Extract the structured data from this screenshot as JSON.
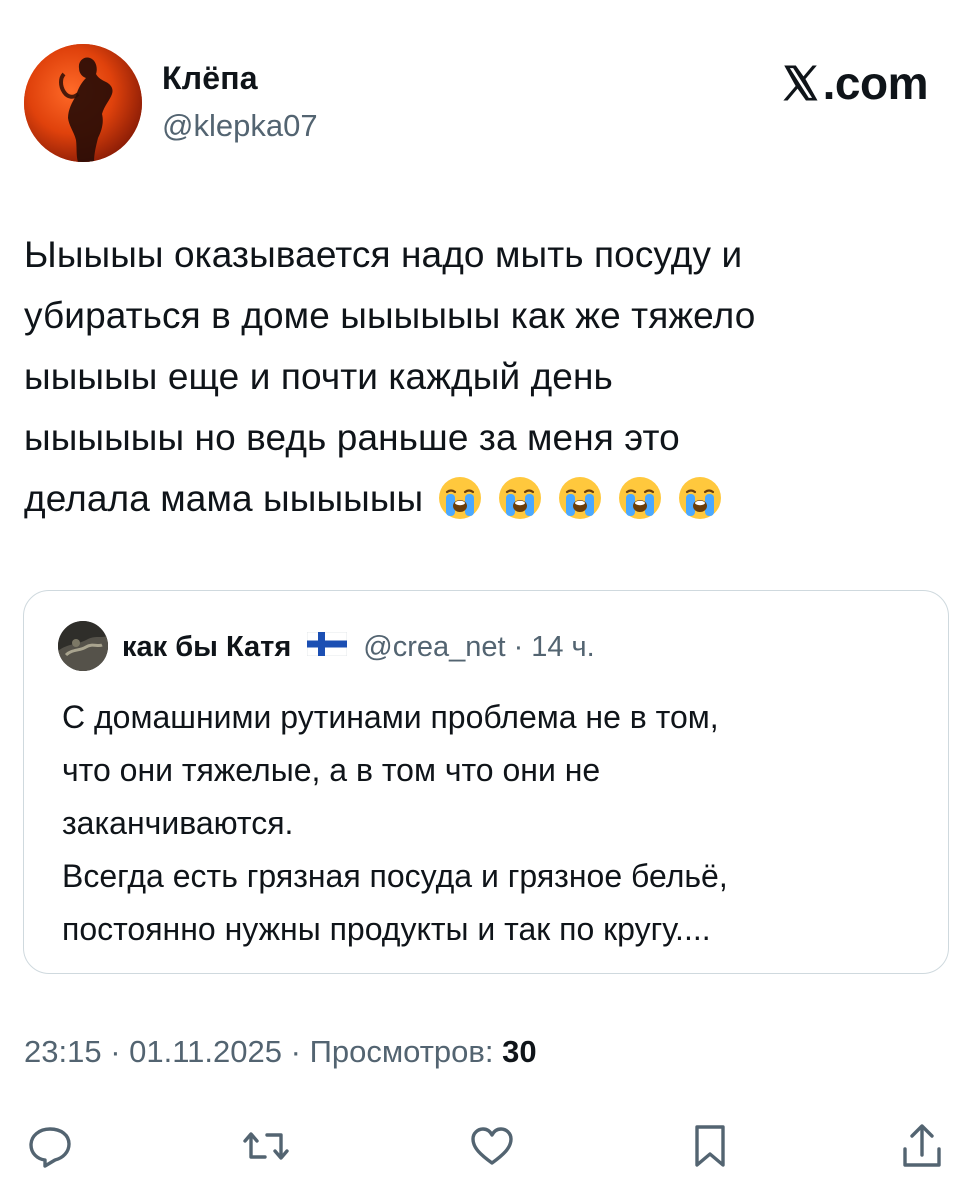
{
  "author": {
    "name": "Клёпа",
    "handle": "@klepka07"
  },
  "brand": {
    "label": ".com"
  },
  "tweet": {
    "text_lines": [
      "Ыыыыы оказывается надо мыть посуду и",
      "убираться в доме ыыыыыы как же тяжело",
      "ыыыыы еще и почти каждый день",
      "ыыыыыы но ведь раньше за меня это",
      "делала мама ыыыыыы"
    ],
    "emojis": [
      "loudly-crying-face",
      "loudly-crying-face",
      "loudly-crying-face",
      "loudly-crying-face",
      "loudly-crying-face"
    ]
  },
  "quote": {
    "name": "как бы Катя",
    "flag": "finland-flag",
    "handle": "@crea_net",
    "dot": "·",
    "time": "14 ч.",
    "body_lines": [
      "С домашними рутинами проблема не в том,",
      "что они тяжелые, а в том что они не",
      "заканчиваются.",
      "Всегда есть грязная посуда и грязное бельё,",
      "постоянно нужны продукты и так по кругу...."
    ]
  },
  "stats": {
    "time": "23:15",
    "sep1": " · ",
    "date": "01.11.2025",
    "sep2": " · ",
    "views_label": "Просмотров: ",
    "views_count": "30"
  },
  "actions": {
    "reply": "reply-icon",
    "retweet": "retweet-icon",
    "like": "like-icon",
    "bookmark": "bookmark-icon",
    "share": "share-icon"
  },
  "colors": {
    "text": "#0f1419",
    "secondary": "#536471",
    "border": "#cfd9de",
    "avatar_orange": "#e8400a"
  }
}
